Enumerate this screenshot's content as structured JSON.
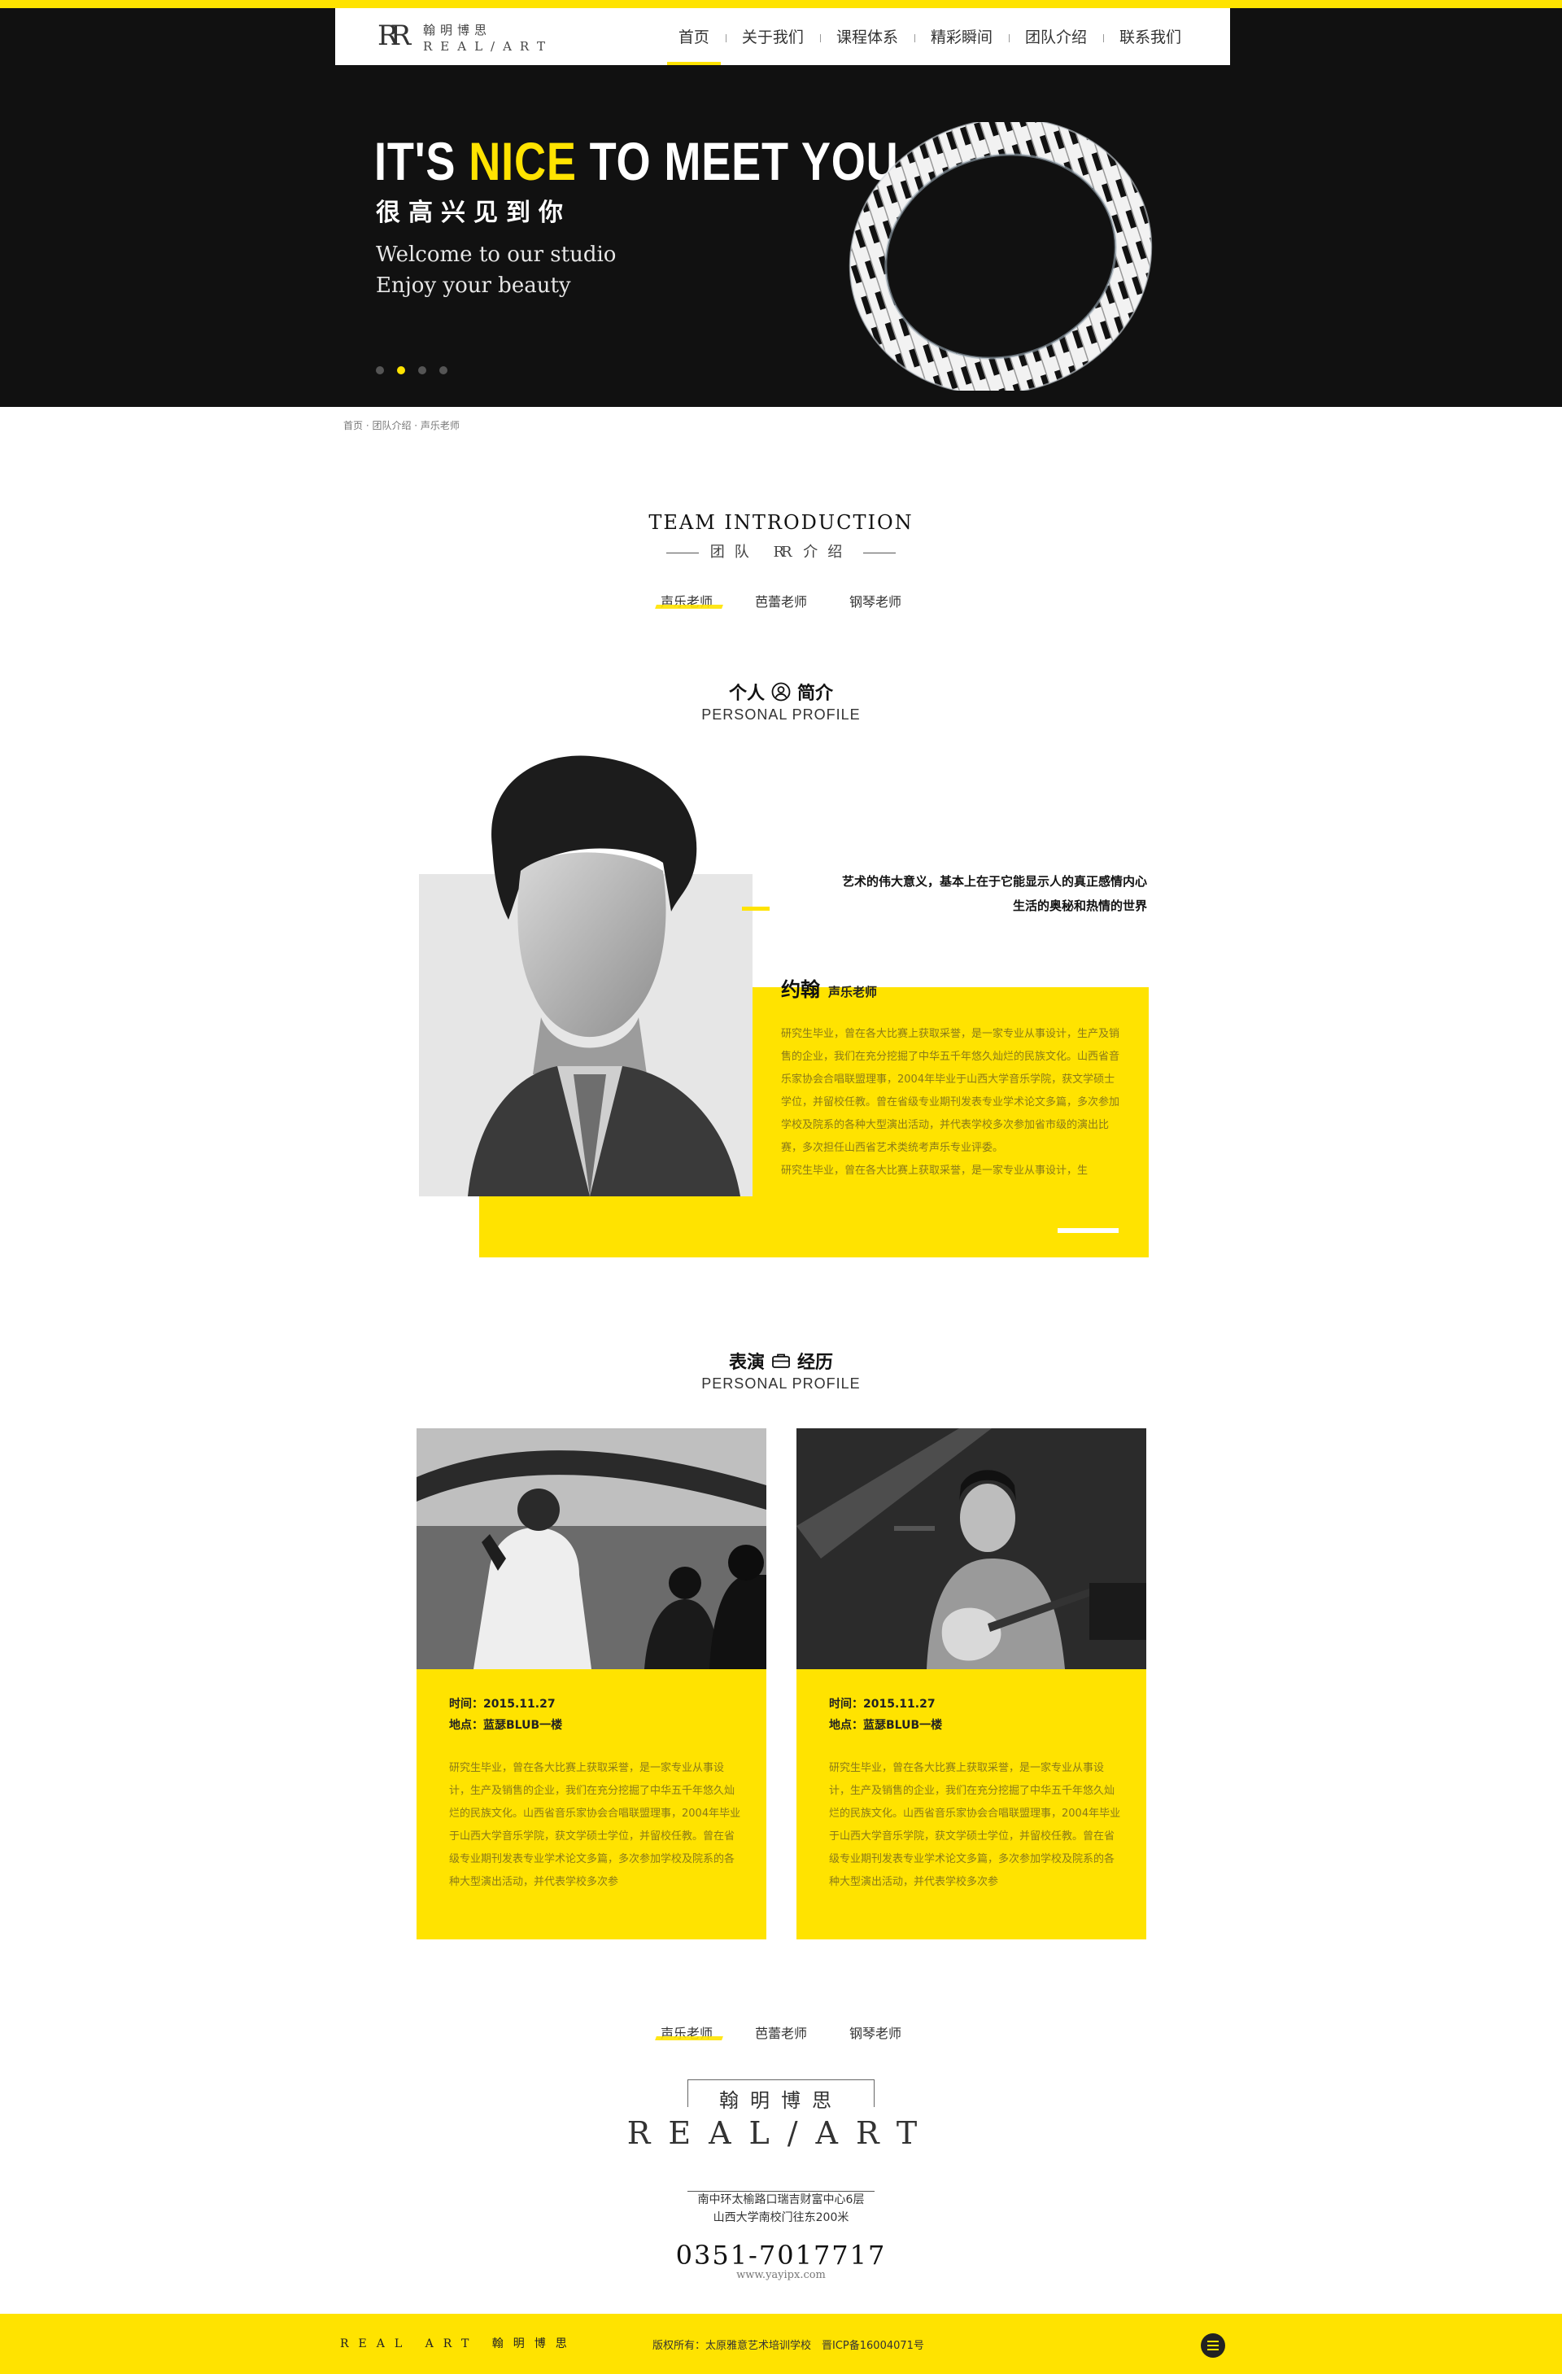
{
  "nav": {
    "logo_mark": "RR",
    "logo_cn": "翰明博思",
    "logo_en": "REAL/ART",
    "items": [
      {
        "label": "首页"
      },
      {
        "label": "关于我们"
      },
      {
        "label": "课程体系"
      },
      {
        "label": "精彩瞬间"
      },
      {
        "label": "团队介绍"
      },
      {
        "label": "联系我们"
      }
    ],
    "active_index": 0
  },
  "hero": {
    "title_a": "IT'S ",
    "title_nice": "NICE",
    "title_b": " TO MEET YOU",
    "subtitle_cn": "很高兴见到你",
    "welcome_1": "Welcome to our studio",
    "welcome_2": "Enjoy your beauty",
    "slide_count": 4,
    "active_slide": 1
  },
  "breadcrumb": "首页 · 团队介绍 · 声乐老师",
  "team": {
    "title_en": "TEAM INTRODUCTION",
    "title_cn_left": "团队",
    "title_cn_mark": "RR",
    "title_cn_right": "介绍",
    "tabs": [
      "声乐老师",
      "芭蕾老师",
      "钢琴老师"
    ],
    "active_tab": 0
  },
  "profile": {
    "head_cn_a": "个人",
    "head_cn_b": "简介",
    "head_en": "PERSONAL PROFILE",
    "quote_1": "艺术的伟大意义，基本上在于它能显示人的真正感情内心",
    "quote_2": "生活的奥秘和热情的世界",
    "name": "约翰",
    "role": "声乐老师",
    "bio": "研究生毕业，曾在各大比赛上获取采誉，是一家专业从事设计，生产及销售的企业，我们在充分挖掘了中华五千年悠久灿烂的民族文化。山西省音乐家协会合唱联盟理事，2004年毕业于山西大学音乐学院，获文学硕士学位，并留校任教。曾在省级专业期刊发表专业学术论文多篇，多次参加学校及院系的各种大型演出活动，并代表学校多次参加省市级的演出比赛，多次担任山西省艺术类统考声乐专业评委。",
    "bio_2": "研究生毕业，曾在各大比赛上获取采誉，是一家专业从事设计，生"
  },
  "performance": {
    "head_cn_a": "表演",
    "head_cn_b": "经历",
    "head_en": "PERSONAL PROFILE",
    "cards": [
      {
        "time": "时间：2015.11.27",
        "place": "地点：蓝瑟BLUB一楼",
        "text": "研究生毕业，曾在各大比赛上获取采誉，是一家专业从事设计，生产及销售的企业，我们在充分挖掘了中华五千年悠久灿烂的民族文化。山西省音乐家协会合唱联盟理事，2004年毕业于山西大学音乐学院，获文学硕士学位，并留校任教。曾在省级专业期刊发表专业学术论文多篇，多次参加学校及院系的各种大型演出活动，并代表学校多次参"
      },
      {
        "time": "时间：2015.11.27",
        "place": "地点：蓝瑟BLUB一楼",
        "text": "研究生毕业，曾在各大比赛上获取采誉，是一家专业从事设计，生产及销售的企业，我们在充分挖掘了中华五千年悠久灿烂的民族文化。山西省音乐家协会合唱联盟理事，2004年毕业于山西大学音乐学院，获文学硕士学位，并留校任教。曾在省级专业期刊发表专业学术论文多篇，多次参加学校及院系的各种大型演出活动，并代表学校多次参"
      }
    ]
  },
  "bottom_tabs": [
    "声乐老师",
    "芭蕾老师",
    "钢琴老师"
  ],
  "footer": {
    "logo_cn": "翰明博思",
    "logo_en": "REAL/ART",
    "address_1": "南中环太榆路口瑞吉财富中心6层",
    "address_2": "山西大学南校门往东200米",
    "phone": "0351-7017717",
    "website": "www.yayipx.com",
    "bar_logo": "REAL ART 翰明博思",
    "copyright": "版权所有：太原雅意艺术培训学校",
    "icp": "晋ICP备16004071号"
  },
  "colors": {
    "accent": "#ffe300",
    "dark": "#111111",
    "bio_text": "#8a7a1a"
  }
}
